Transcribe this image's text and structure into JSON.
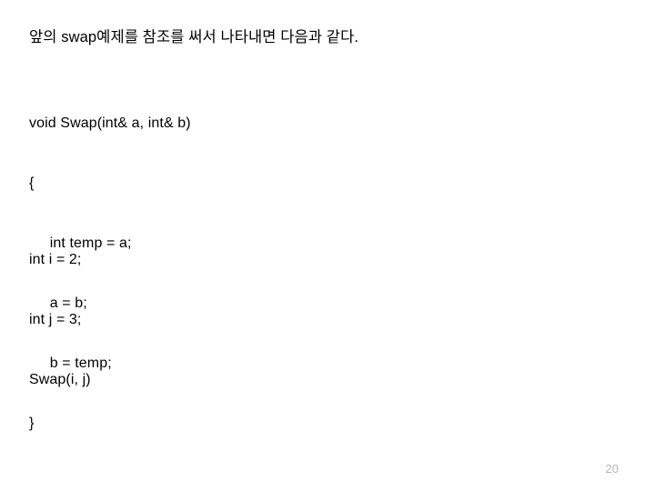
{
  "slide": {
    "background_color": "#ffffff",
    "text_color": "#000000",
    "intro_text": "앞의 swap예제를 참조를 써서 나타내면 다음과 같다.",
    "code_function": [
      "void Swap(int& a, int& b)",
      "{",
      "     int temp = a;",
      "     a = b;",
      "     b = temp;",
      "}"
    ],
    "code_call": [
      "int i = 2;",
      "int j = 3;",
      "Swap(i, j)"
    ],
    "page_number": "20",
    "page_number_color": "#b4b4b4"
  }
}
